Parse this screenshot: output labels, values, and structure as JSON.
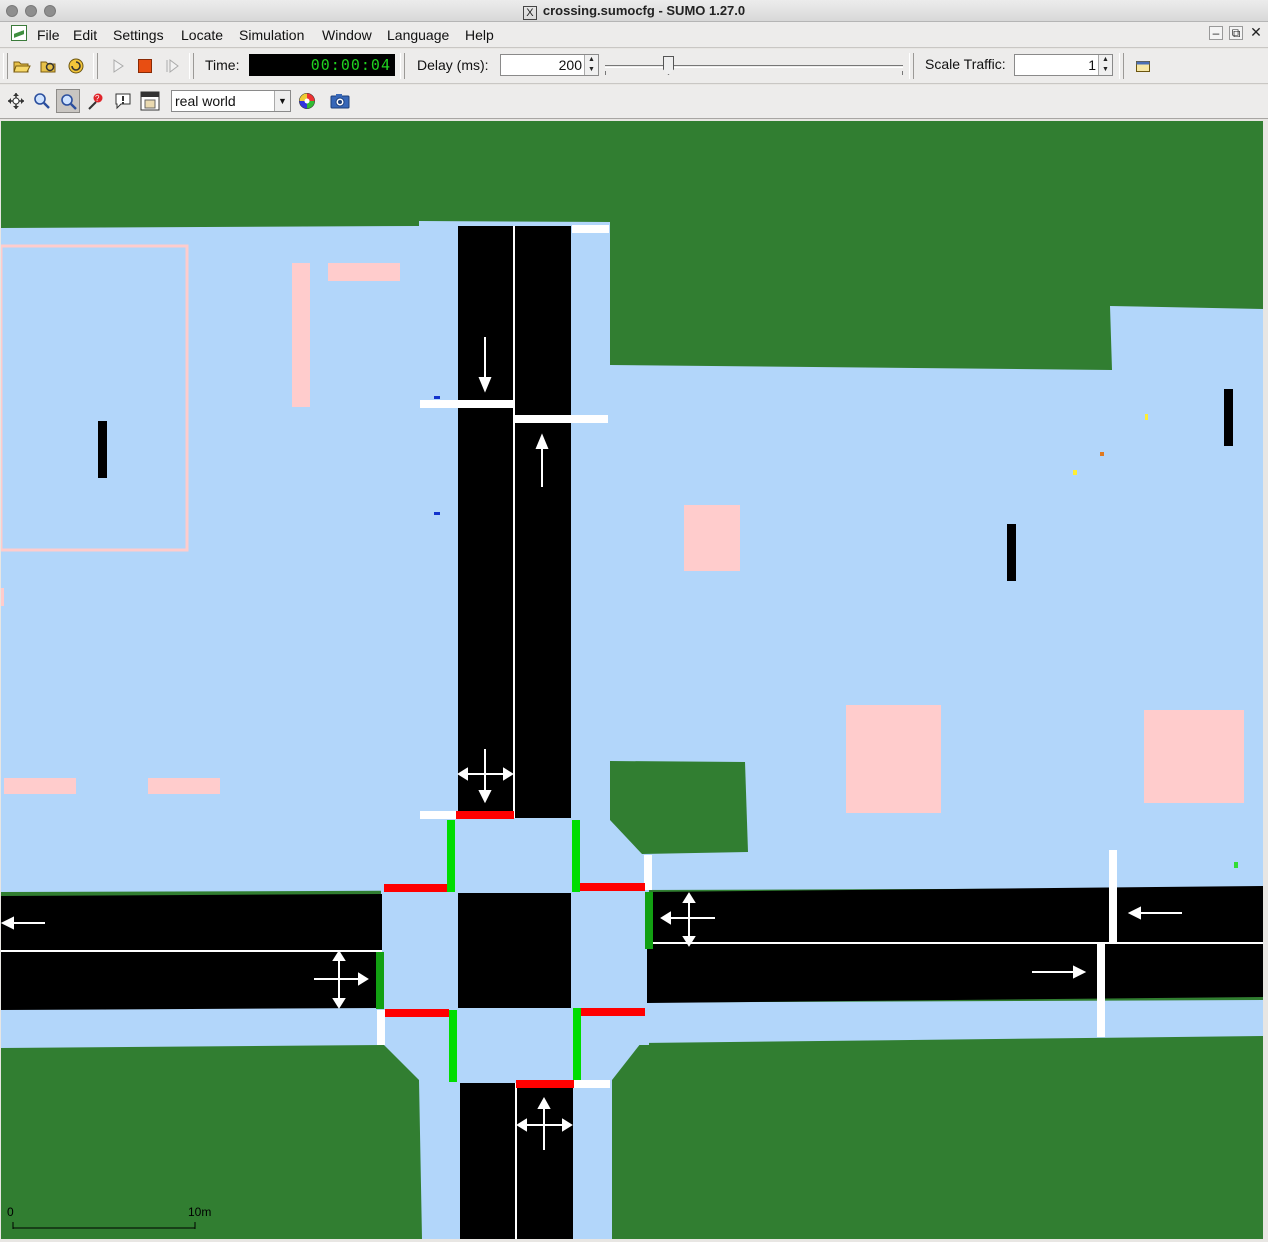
{
  "window": {
    "title": "crossing.sumocfg - SUMO 1.27.0",
    "x_glyph": "X"
  },
  "menubar": {
    "items": [
      {
        "id": "file",
        "label": "File"
      },
      {
        "id": "edit",
        "label": "Edit"
      },
      {
        "id": "settings",
        "label": "Settings"
      },
      {
        "id": "locate",
        "label": "Locate"
      },
      {
        "id": "simulation",
        "label": "Simulation"
      },
      {
        "id": "window",
        "label": "Window"
      },
      {
        "id": "language",
        "label": "Language"
      },
      {
        "id": "help",
        "label": "Help"
      }
    ],
    "window_buttons": [
      "minimize-icon",
      "restore-icon",
      "close-icon"
    ]
  },
  "toolbar": {
    "time_label": "Time:",
    "time_value": "00:00:04",
    "delay_label": "Delay (ms):",
    "delay_value": "200",
    "scale_label": "Scale Traffic:",
    "scale_value": "1",
    "buttons": [
      "open-icon",
      "reload-icon",
      "reload-net-icon",
      "run-icon",
      "stop-icon",
      "step-icon",
      "dock-icon"
    ]
  },
  "viewtoolbar": {
    "scheme_value": "real world",
    "buttons": [
      "recenter-icon",
      "zoom-icon",
      "select-icon",
      "locator-icon",
      "breakpoint-icon",
      "menu-icon",
      "color-wheel-icon",
      "camera-icon"
    ]
  },
  "map": {
    "colors": {
      "grass": "#317e31",
      "sidewalk": "#b2d6fa",
      "road": "#000000",
      "building": "#ffcccc",
      "tls_red": "#ff0000",
      "tls_green": "#00dd00",
      "marking": "#ffffff"
    },
    "scale_left": "0",
    "scale_right": "10m"
  }
}
